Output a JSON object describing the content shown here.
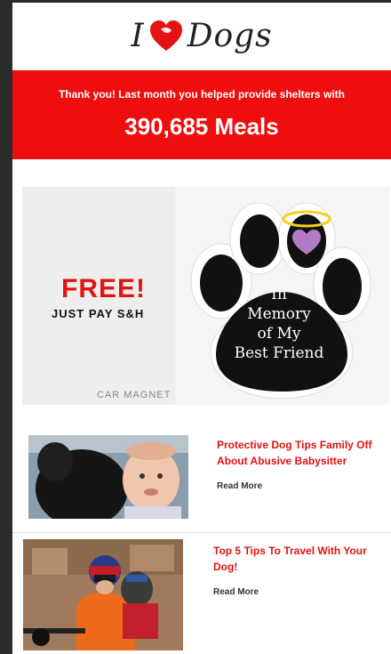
{
  "logo": {
    "left_text": "I",
    "right_text": "Dogs",
    "heart_color": "#e41212"
  },
  "banner": {
    "line": "Thank you! Last month you helped provide shelters with",
    "big": "390,685 Meals",
    "color": "#ee0e0e"
  },
  "promo": {
    "headline": "FREE!",
    "subline": "JUST PAY S&H",
    "caption": "CAR MAGNET",
    "magnet_lines": [
      "In",
      "Memory",
      "of My",
      "Best Friend"
    ]
  },
  "articles": [
    {
      "title_line1": "Protective Dog Tips Family Off",
      "title_line2": "About Abusive Babysitter",
      "link": "Read More"
    },
    {
      "title_line1": "Top 5 Tips To Travel With Your",
      "title_line2": "Dog!",
      "link": "Read More"
    }
  ]
}
